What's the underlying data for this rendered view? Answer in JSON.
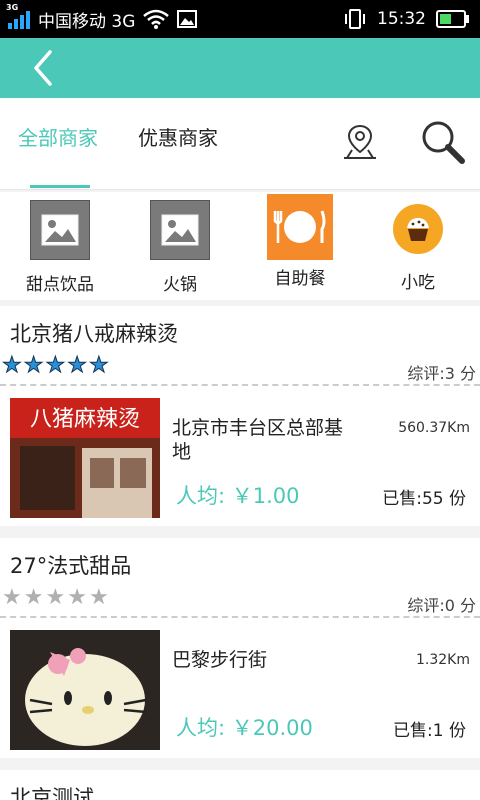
{
  "status_bar": {
    "network_type": "3G",
    "carrier": "中国移动 3G",
    "time": "15:32"
  },
  "header": {
    "back_icon": "back-chevron-icon"
  },
  "tabs": [
    {
      "label": "全部商家",
      "active": true
    },
    {
      "label": "优惠商家",
      "active": false
    }
  ],
  "header_actions": {
    "location_icon": "location-pin-icon",
    "search_icon": "search-icon"
  },
  "categories": [
    {
      "label": "甜点饮品",
      "icon": "image-placeholder-icon"
    },
    {
      "label": "火锅",
      "icon": "image-placeholder-icon"
    },
    {
      "label": "自助餐",
      "icon": "plate-fork-knife-icon"
    },
    {
      "label": "小吃",
      "icon": "cupcake-icon"
    }
  ],
  "shops": [
    {
      "name": "北京猪八戒麻辣烫",
      "rating_stars": 5,
      "score": "综评:3 分",
      "thumbnail_sign_text": "八猪麻辣烫",
      "address": "北京市丰台区总部基地",
      "distance": "560.37Km",
      "avg_price": "人均: ￥1.00",
      "sold": "已售:55 份"
    },
    {
      "name": "27°法式甜品",
      "rating_stars": 0,
      "score": "综评:0 分",
      "address": "巴黎步行街",
      "distance": "1.32Km",
      "avg_price": "人均: ￥20.00",
      "sold": "已售:1 份"
    },
    {
      "name": "北京测试"
    }
  ],
  "colors": {
    "accent": "#4cc8b8",
    "star_on": "#2a8fd4",
    "star_off": "#b0b0b0",
    "buffet_orange": "#f58a2a"
  }
}
